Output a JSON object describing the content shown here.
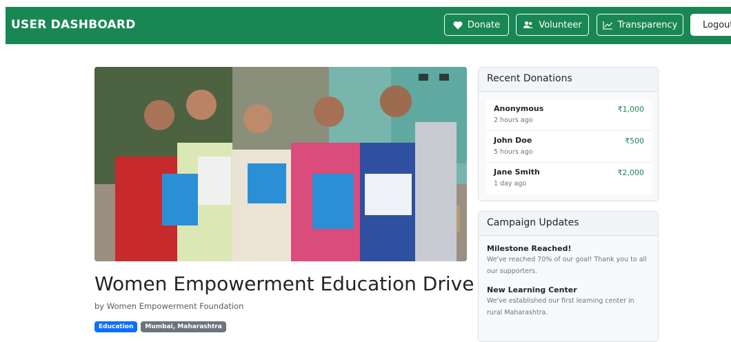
{
  "navbar": {
    "brand": "USER DASHBOARD",
    "buttons": [
      {
        "label": "Donate",
        "icon": "heart-icon"
      },
      {
        "label": "Volunteer",
        "icon": "users-icon"
      },
      {
        "label": "Transparency",
        "icon": "chart-line-icon"
      },
      {
        "label": "Logout"
      }
    ]
  },
  "campaign": {
    "title": "Women Empowerment Education Drive",
    "byline": "by Women Empowerment Foundation",
    "badges": [
      "Education",
      "Mumbai, Maharashtra"
    ]
  },
  "donations": {
    "header": "Recent Donations",
    "items": [
      {
        "name": "Anonymous",
        "time": "2 hours ago",
        "amount": "₹1,000"
      },
      {
        "name": "John Doe",
        "time": "5 hours ago",
        "amount": "₹500"
      },
      {
        "name": "Jane Smith",
        "time": "1 day ago",
        "amount": "₹2,000"
      }
    ]
  },
  "updates": {
    "header": "Campaign Updates",
    "items": [
      {
        "title": "Milestone Reached!",
        "text": "We've reached 70% of our goal! Thank you to all our supporters."
      },
      {
        "title": "New Learning Center",
        "text": "We've established our first learning center in rural Maharashtra."
      }
    ]
  },
  "colors": {
    "primary": "#198754",
    "badge_blue": "#0d6efd",
    "badge_grey": "#6c757d"
  }
}
